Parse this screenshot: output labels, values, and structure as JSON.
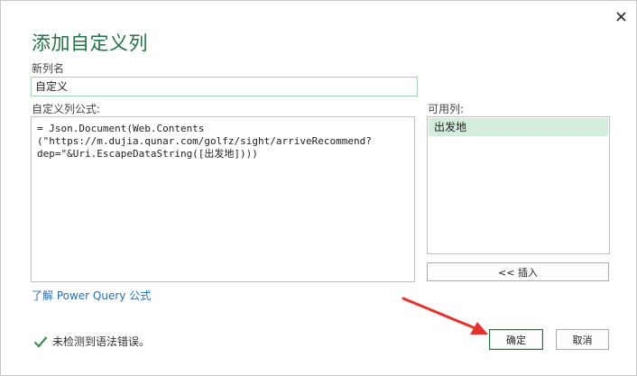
{
  "dialog": {
    "title": "添加自定义列",
    "close_icon": "close-icon"
  },
  "name_field": {
    "label": "新列名",
    "value": "自定义"
  },
  "formula_field": {
    "label": "自定义列公式:",
    "lines": [
      "= Json.Document(Web.Contents",
      "(\"https://m.dujia.qunar.com/golfz/sight/arriveRecommend?",
      "dep=\"&Uri.EscapeDataString([出发地])))"
    ]
  },
  "available_columns": {
    "label": "可用列:",
    "items": [
      "出发地"
    ],
    "insert_button": "<< 插入"
  },
  "help_link": "了解 Power Query 公式",
  "status": {
    "icon": "checkmark-icon",
    "text": "未检测到语法错误。"
  },
  "buttons": {
    "ok": "确定",
    "cancel": "取消"
  },
  "colors": {
    "accent_green": "#217346",
    "selected_item": "#d4ecdc",
    "annotation_arrow": "#e5322d"
  }
}
